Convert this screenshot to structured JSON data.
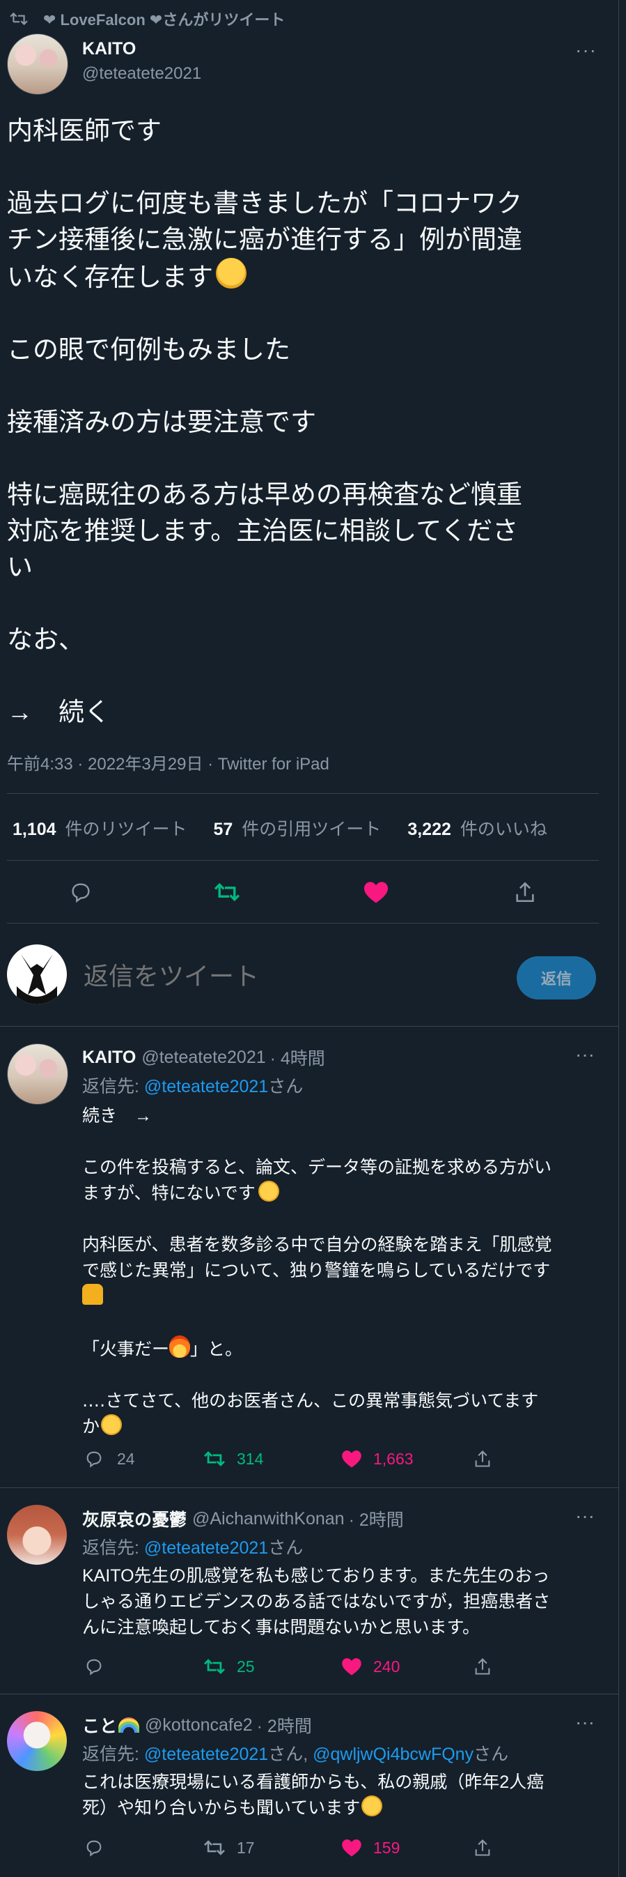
{
  "retweet_banner": {
    "text": "❤ LoveFalcon ❤さんがリツイート"
  },
  "main_tweet": {
    "author_name": "KAITO",
    "handle": "@teteatete2021",
    "lines": [
      "内科医師です",
      "",
      "過去ログに何度も書きましたが「コロナワク",
      "チン接種後に急激に癌が進行する」例が間違",
      "いなく存在します",
      "",
      "この眼で何例もみました",
      "",
      "接種済みの方は要注意です",
      "",
      "特に癌既往のある方は早めの再検査など慎重",
      "対応を推奨します。主治医に相談してくださ",
      "い",
      "",
      "なお、",
      "",
      "→　続く"
    ],
    "meta": "午前4:33 · 2022年3月29日 · Twitter for iPad",
    "stats": {
      "retweets": "1,104",
      "retweets_label": "件のリツイート",
      "quotes": "57",
      "quotes_label": "件の引用ツイート",
      "likes": "3,222",
      "likes_label": "件のいいね"
    }
  },
  "compose": {
    "placeholder": "返信をツイート",
    "button": "返信"
  },
  "replies": [
    {
      "name": "KAITO",
      "handle": "@teteatete2021",
      "time": "· 4時間",
      "reply_to_prefix": "返信先: ",
      "reply_to": "@teteatete2021",
      "reply_to_suffix": "さん",
      "lines": [
        "続き　→",
        "",
        "この件を投稿すると、論文、データ等の証拠を求める方がい",
        "ますが、特にないです",
        "",
        "内科医が、患者を数多診る中で自分の経験を踏まえ「肌感覚",
        "で感じた異常」について、独り警鐘を鳴らしているだけです",
        "",
        "",
        "「火事だー」と。",
        "",
        "‥‥さてさて、他のお医者さん、この異常事態気づいてます",
        "か"
      ],
      "replies_count": "24",
      "retweets": "314",
      "likes": "1,663"
    },
    {
      "name": "灰原哀の憂鬱",
      "handle": "@AichanwithKonan",
      "time": "· 2時間",
      "reply_to_prefix": "返信先: ",
      "reply_to": "@teteatete2021",
      "reply_to_suffix": "さん",
      "lines": [
        "KAITO先生の肌感覚を私も感じております。また先生のおっ",
        "しゃる通りエビデンスのある話ではないですが，担癌患者さ",
        "んに注意喚起しておく事は問題ないかと思います。"
      ],
      "replies_count": "",
      "retweets": "25",
      "likes": "240"
    },
    {
      "name": "こと",
      "handle": "@kottoncafe2",
      "time": "· 2時間",
      "reply_to_prefix": "返信先: ",
      "reply_to": "@teteatete2021",
      "reply_to_mid": "さん, ",
      "reply_to2": "@qwljwQi4bcwFQny",
      "reply_to_suffix": "さん",
      "lines": [
        "これは医療現場にいる看護師からも、私の親戚（昨年2人癌",
        "死）や知り合いからも聞いています"
      ],
      "replies_count": "",
      "retweets": "17",
      "likes": "159"
    }
  ],
  "colors": {
    "background": "#15202b",
    "text": "#f7f9f9",
    "muted": "#8b98a5",
    "link": "#1d9bf0",
    "retweet_green": "#00ba7c",
    "like_pink": "#f91880"
  }
}
